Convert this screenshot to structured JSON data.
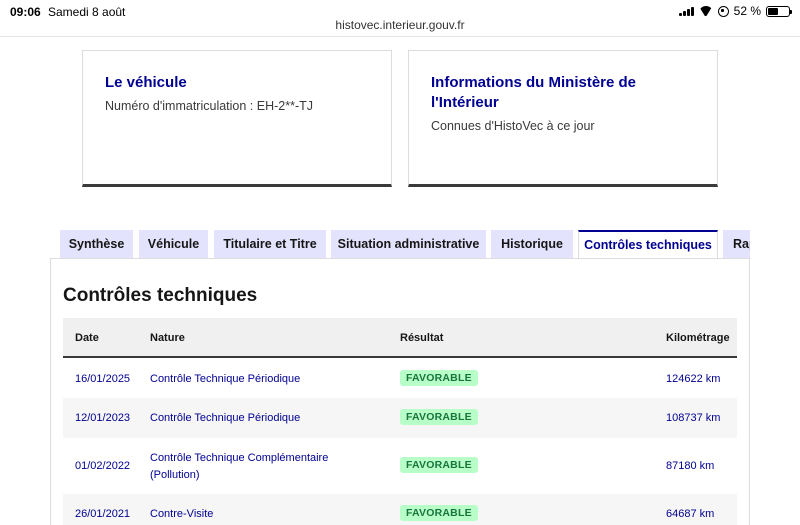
{
  "status_bar": {
    "time": "09:06",
    "date": "Samedi 8 août",
    "battery": "52 %",
    "battery_level": 0.52
  },
  "browser": {
    "url": "histovec.interieur.gouv.fr"
  },
  "cards": {
    "vehicle": {
      "title": "Le véhicule",
      "plate": "Numéro d'immatriculation : EH-2**-TJ"
    },
    "ministry": {
      "title": "Informations du Ministère de l'Intérieur",
      "subtitle": "Connues d'HistoVec à ce jour"
    }
  },
  "tabs": [
    {
      "label": "Synthèse",
      "active": false
    },
    {
      "label": "Véhicule",
      "active": false
    },
    {
      "label": "Titulaire et Titre",
      "active": false
    },
    {
      "label": "Situation administrative",
      "active": false
    },
    {
      "label": "Historique",
      "active": false
    },
    {
      "label": "Contrôles techniques",
      "active": true
    },
    {
      "label": "Rap",
      "active": false
    }
  ],
  "section": {
    "title": "Contrôles techniques",
    "columns": {
      "date": "Date",
      "nature": "Nature",
      "result": "Résultat",
      "km": "Kilométrage"
    },
    "rows": [
      {
        "date": "16/01/2025",
        "nature": "Contrôle Technique Périodique",
        "nature2": "",
        "result": "FAVORABLE",
        "km": "124622 km"
      },
      {
        "date": "12/01/2023",
        "nature": "Contrôle Technique Périodique",
        "nature2": "",
        "result": "FAVORABLE",
        "km": "108737 km"
      },
      {
        "date": "01/02/2022",
        "nature": "Contrôle Technique Complémentaire",
        "nature2": "(Pollution)",
        "result": "FAVORABLE",
        "km": "87180 km"
      },
      {
        "date": "26/01/2021",
        "nature": "Contre-Visite",
        "nature2": "",
        "result": "FAVORABLE",
        "km": "64687 km"
      }
    ]
  }
}
